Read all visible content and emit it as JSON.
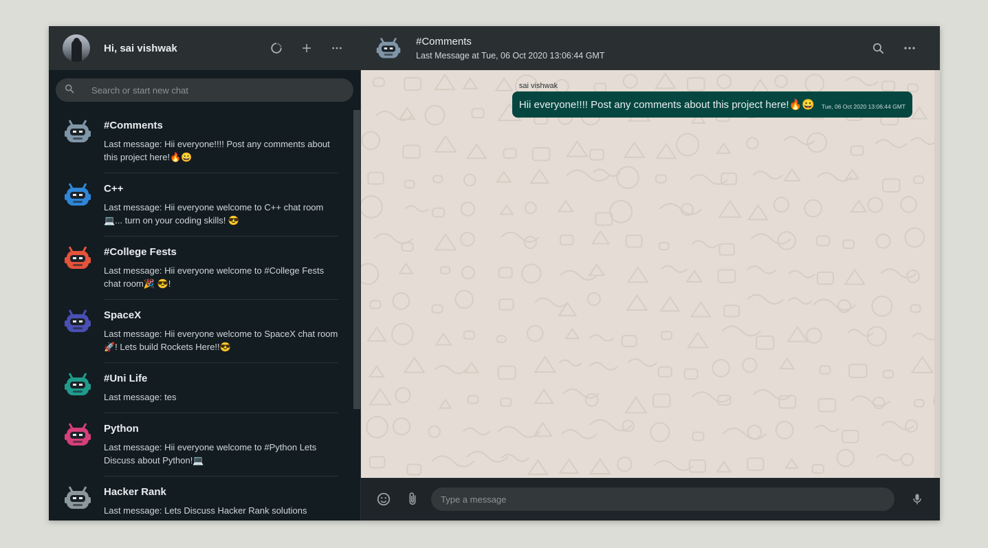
{
  "sidebar": {
    "greeting": "Hi, sai vishwak",
    "icons": [
      "refresh-icon",
      "plus-icon",
      "more-icon"
    ],
    "search": {
      "placeholder": "Search or start new chat"
    },
    "chats": [
      {
        "name": "#Comments",
        "message": "Last message: Hii everyone!!!! Post any comments about this project here!🔥😀",
        "avatar": "robot-gray",
        "color": "#7f96a8"
      },
      {
        "name": "C++",
        "message": "Last message: Hii everyone welcome to C++ chat room 💻... turn on your coding skills! 😎",
        "avatar": "robot-blue",
        "color": "#2f86d8"
      },
      {
        "name": "#College Fests",
        "message": "Last message: Hii everyone welcome to #College Fests chat room🎉 😎!",
        "avatar": "robot-orange",
        "color": "#e5533a"
      },
      {
        "name": "SpaceX",
        "message": "Last message: Hii everyone welcome to SpaceX chat room🚀! Lets build Rockets Here!!😎",
        "avatar": "robot-indigo",
        "color": "#4a4fb5"
      },
      {
        "name": "#Uni Life",
        "message": "Last message: tes",
        "avatar": "robot-teal",
        "color": "#1f9b8c"
      },
      {
        "name": "Python",
        "message": "Last message: Hii everyone welcome to #Python Lets Discuss about Python!💻",
        "avatar": "robot-pink",
        "color": "#d63f78"
      },
      {
        "name": "Hacker Rank",
        "message": "Last message: Lets Discuss Hacker Rank solutions",
        "avatar": "robot-silver",
        "color": "#8d979e"
      }
    ]
  },
  "main": {
    "title": "#Comments",
    "subtitle": "Last Message at Tue, 06 Oct 2020 13:06:44 GMT",
    "icons": [
      "search-icon",
      "more-icon"
    ],
    "message": {
      "sender": "sai vishwak",
      "text": "Hii everyone!!!! Post any comments about this project here!🔥😀",
      "time": "Tue, 06 Oct 2020 13:06:44 GMT"
    },
    "composer": {
      "placeholder": "Type a message"
    }
  },
  "colors": {
    "sidebar_bg": "#131c21",
    "header_bg": "#2a2f32",
    "bubble_outgoing": "#054740",
    "chat_bg": "#e5ddd5"
  }
}
